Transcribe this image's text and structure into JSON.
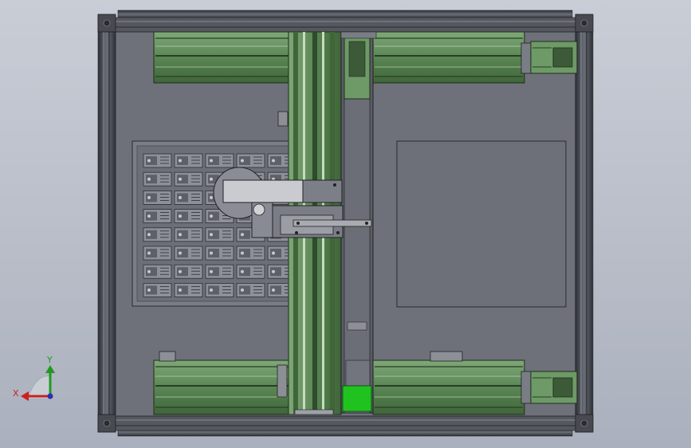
{
  "viewport": {
    "background_top": "#c9cdd6",
    "background_bottom": "#aab0bd"
  },
  "colors": {
    "frame_dark": "#3a3d44",
    "frame_mid": "#5c6068",
    "plate": "#6f727b",
    "rail_green": "#5f8a5a",
    "rail_green_dark": "#2f4a2c",
    "rail_green_light": "#8fb486",
    "slot_grey": "#9a9ca3",
    "bright_green": "#1fc21f"
  },
  "triad": {
    "x_label": "X",
    "y_label": "Y",
    "x_color": "#cc1f1f",
    "y_color": "#1f9a1f",
    "z_color": "#2a2fb0"
  },
  "icons": {
    "triad": "xyz-axis-triad-icon"
  }
}
